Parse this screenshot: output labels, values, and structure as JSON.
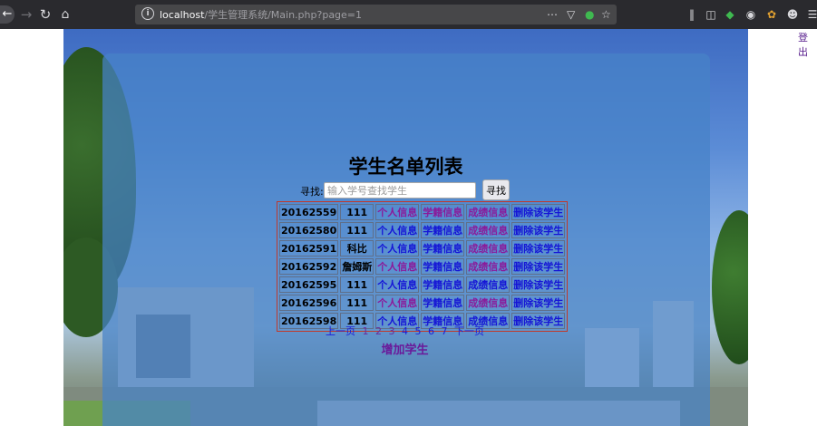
{
  "browser": {
    "url_host": "localhost",
    "url_path": "/学生管理系统/Main.php?page=1"
  },
  "page": {
    "logout": "登出",
    "title": "学生名单列表",
    "search": {
      "label": "寻找:",
      "placeholder": "输入学号查找学生",
      "button": "寻找"
    },
    "rows": [
      {
        "id": "20162559",
        "cls": "111"
      },
      {
        "id": "20162580",
        "cls": "111"
      },
      {
        "id": "20162591",
        "cls": "科比"
      },
      {
        "id": "20162592",
        "cls": "詹姆斯"
      },
      {
        "id": "20162595",
        "cls": "111"
      },
      {
        "id": "20162596",
        "cls": "111"
      },
      {
        "id": "20162598",
        "cls": "111"
      }
    ],
    "links": {
      "personal": "个人信息",
      "enrollment": "学籍信息",
      "grades": "成绩信息",
      "delete": "删除该学生"
    },
    "pager": {
      "prev": "上一页",
      "pages": [
        "1",
        "2",
        "3",
        "4",
        "5",
        "6",
        "7"
      ],
      "next": "下一页"
    },
    "add": "增加学生"
  }
}
